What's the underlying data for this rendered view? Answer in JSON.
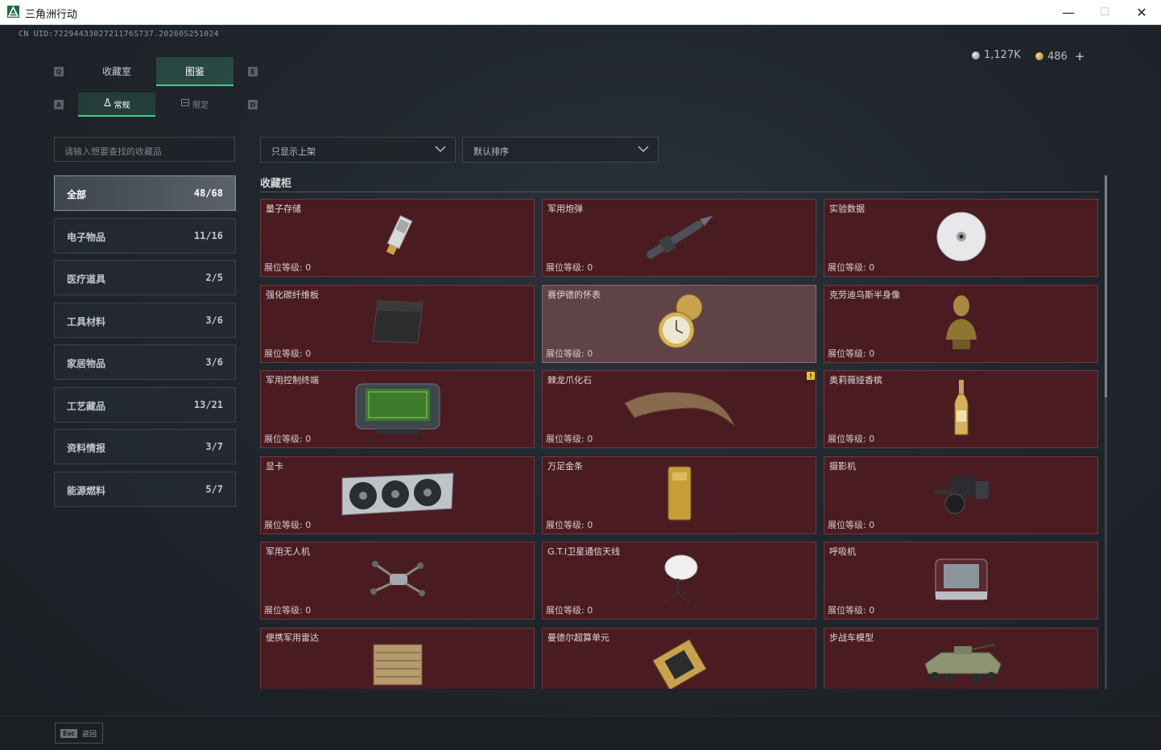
{
  "window": {
    "title": "三角洲行动",
    "minimize": "—",
    "maximize": "☐",
    "close": "✕"
  },
  "uid": "CN UID:7229443302721176S737.20260S251024",
  "currency": {
    "silver": "1,127K",
    "gold": "486",
    "add": "+"
  },
  "hotkeys": {
    "q": "Q",
    "e": "E",
    "a": "A",
    "d": "D"
  },
  "tabs": [
    {
      "label": "收藏室"
    },
    {
      "label": "图鉴"
    }
  ],
  "subtabs": [
    {
      "label": "常规"
    },
    {
      "label": "限定"
    }
  ],
  "search": {
    "placeholder": "请输入想要查找的收藏品"
  },
  "filters": {
    "shelf": "只显示上架",
    "sort": "默认排序"
  },
  "categories": [
    {
      "label": "全部",
      "count": "48/68"
    },
    {
      "label": "电子物品",
      "count": "11/16"
    },
    {
      "label": "医疗道具",
      "count": "2/5"
    },
    {
      "label": "工具材料",
      "count": "3/6"
    },
    {
      "label": "家居物品",
      "count": "3/6"
    },
    {
      "label": "工艺藏品",
      "count": "13/21"
    },
    {
      "label": "资料情报",
      "count": "3/7"
    },
    {
      "label": "能源燃料",
      "count": "5/7"
    }
  ],
  "section_title": "收藏柜",
  "level_text": "展位等级: 0",
  "items": [
    {
      "name": "量子存储",
      "icon": "quantum-storage-icon"
    },
    {
      "name": "军用炮弹",
      "icon": "artillery-shell-icon"
    },
    {
      "name": "实验数据",
      "icon": "disc-icon"
    },
    {
      "name": "强化碳纤维板",
      "icon": "carbon-plate-icon"
    },
    {
      "name": "赛伊德的怀表",
      "icon": "pocket-watch-icon"
    },
    {
      "name": "克劳迪乌斯半身像",
      "icon": "bust-icon"
    },
    {
      "name": "军用控制终端",
      "icon": "control-terminal-icon"
    },
    {
      "name": "棘龙爪化石",
      "icon": "claw-fossil-icon",
      "badge": "!"
    },
    {
      "name": "奥莉薇娅香槟",
      "icon": "champagne-icon"
    },
    {
      "name": "显卡",
      "icon": "gpu-icon"
    },
    {
      "name": "万足金条",
      "icon": "gold-bar-icon"
    },
    {
      "name": "摄影机",
      "icon": "camera-icon"
    },
    {
      "name": "军用无人机",
      "icon": "drone-icon"
    },
    {
      "name": "G.T.I卫星通信天线",
      "icon": "satellite-dish-icon"
    },
    {
      "name": "呼吸机",
      "icon": "ventilator-icon"
    },
    {
      "name": "便携军用雷达",
      "icon": "radar-icon"
    },
    {
      "name": "曼德尔超算单元",
      "icon": "cpu-icon"
    },
    {
      "name": "步战车模型",
      "icon": "ifv-model-icon"
    }
  ],
  "footer": {
    "key": "Esc",
    "label": "返回"
  },
  "colors": {
    "accent": "#3ad18b",
    "card_bg": "#4a1c22",
    "card_highlight": "#5f4346"
  }
}
